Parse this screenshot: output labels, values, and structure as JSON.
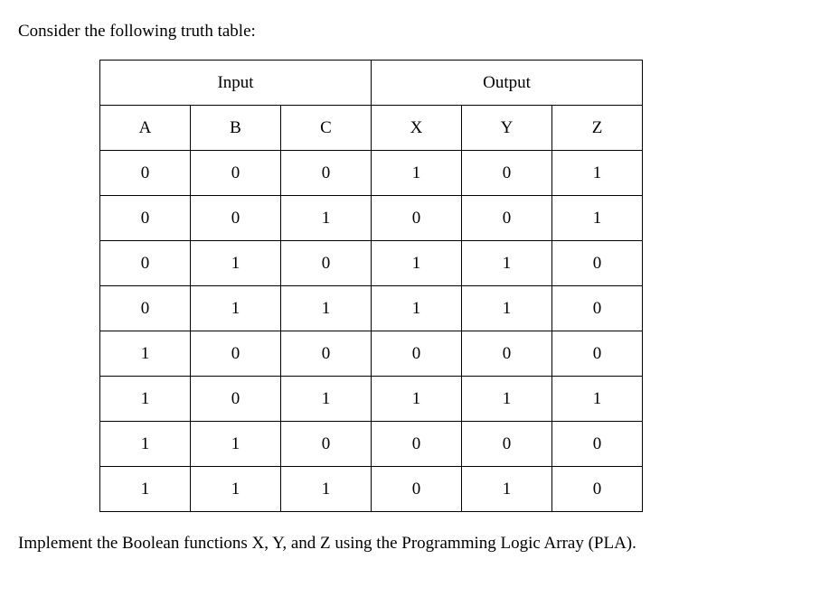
{
  "intro": "Consider the following truth table:",
  "headers": {
    "input_group": "Input",
    "output_group": "Output",
    "cols": [
      "A",
      "B",
      "C",
      "X",
      "Y",
      "Z"
    ]
  },
  "rows": [
    [
      "0",
      "0",
      "0",
      "1",
      "0",
      "1"
    ],
    [
      "0",
      "0",
      "1",
      "0",
      "0",
      "1"
    ],
    [
      "0",
      "1",
      "0",
      "1",
      "1",
      "0"
    ],
    [
      "0",
      "1",
      "1",
      "1",
      "1",
      "0"
    ],
    [
      "1",
      "0",
      "0",
      "0",
      "0",
      "0"
    ],
    [
      "1",
      "0",
      "1",
      "1",
      "1",
      "1"
    ],
    [
      "1",
      "1",
      "0",
      "0",
      "0",
      "0"
    ],
    [
      "1",
      "1",
      "1",
      "0",
      "1",
      "0"
    ]
  ],
  "closing": "Implement the Boolean functions X, Y, and Z using the Programming Logic Array (PLA)."
}
